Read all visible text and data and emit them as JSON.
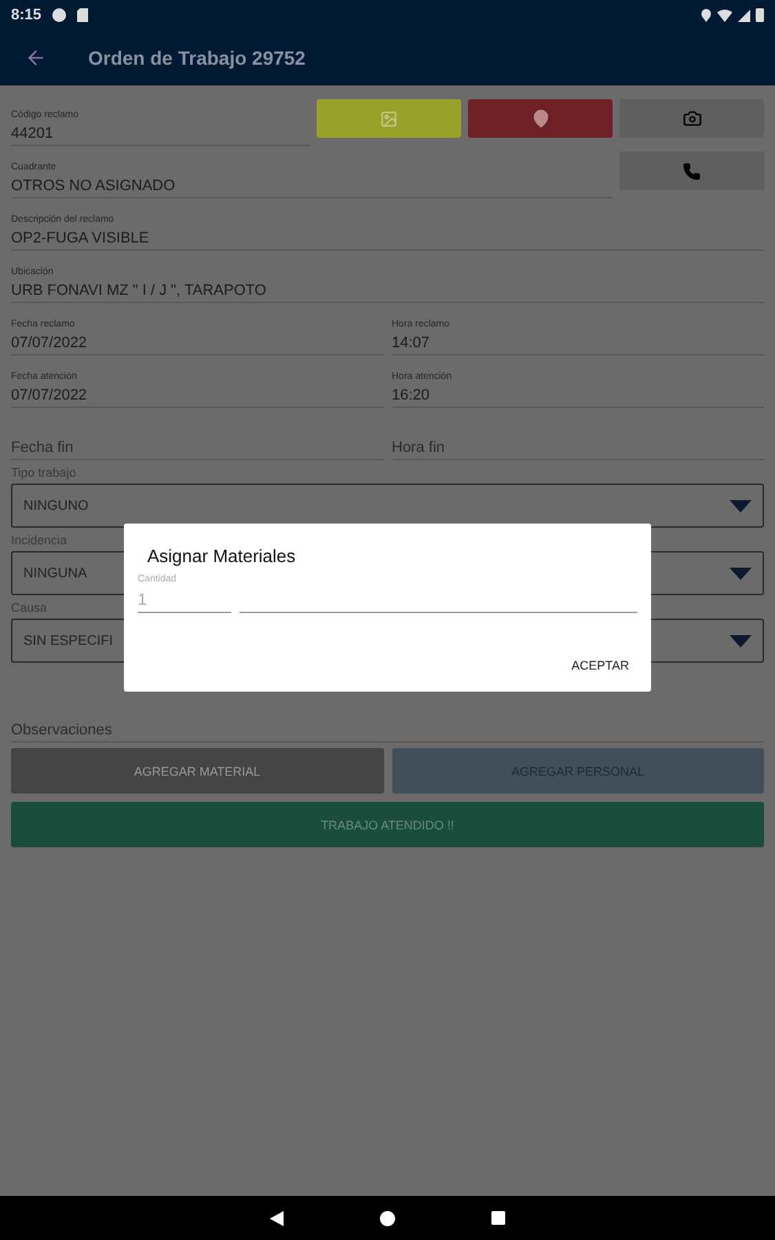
{
  "status_bar": {
    "time": "8:15"
  },
  "app_bar": {
    "title": "Orden de Trabajo 29752"
  },
  "top_fields": [
    {
      "label": "Código reclamo",
      "value": "44201"
    },
    {
      "label": "Cuadrante",
      "value": "OTROS NO ASIGNADO"
    }
  ],
  "full_fields": [
    {
      "label": "Descripción del reclamo",
      "value": "OP2-FUGA VISIBLE"
    },
    {
      "label": "Ubicación",
      "value": "URB FONAVI MZ \" I / J \", TARAPOTO"
    }
  ],
  "pair_fields": [
    {
      "label": "Fecha reclamo",
      "value": "07/07/2022"
    },
    {
      "label": "Hora reclamo",
      "value": "14:07"
    },
    {
      "label": "Fecha atención",
      "value": "07/07/2022"
    },
    {
      "label": "Hora atención",
      "value": "16:20"
    },
    {
      "placeholder": "Fecha fin"
    },
    {
      "placeholder": "Hora fin"
    }
  ],
  "selects": [
    {
      "label": "Tipo trabajo",
      "value": "NINGUNO"
    },
    {
      "label": "Incidencia",
      "value": "NINGUNA"
    },
    {
      "label": "Causa",
      "value": "SIN ESPECIFI"
    }
  ],
  "observations": {
    "placeholder": "Observaciones"
  },
  "buttons": [
    {
      "label": "AGREGAR MATERIAL",
      "kind": "material"
    },
    {
      "label": "AGREGAR PERSONAL",
      "kind": "personal"
    },
    {
      "label": "TRABAJO ATENDIDO !!",
      "kind": "done"
    }
  ],
  "dialog": {
    "title": "Asignar Materiales",
    "quantity_label": "Cantidad",
    "quantity_value": "1",
    "action": "ACEPTAR"
  }
}
